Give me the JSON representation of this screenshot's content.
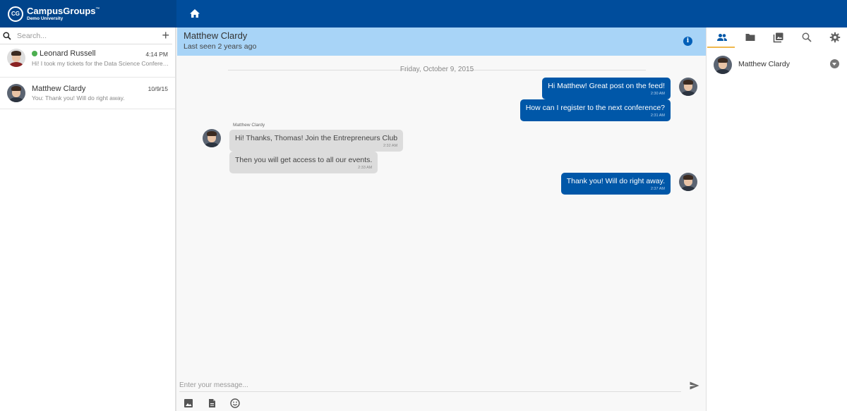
{
  "brand": {
    "name": "CampusGroups",
    "tm": "™",
    "sub": "Demo University",
    "logo_text": "CG"
  },
  "search": {
    "placeholder": "Search..."
  },
  "conversations": [
    {
      "name": "Leonard Russell",
      "time": "4:14 PM",
      "preview": "Hi! I took my tickets for the Data Science Conference!",
      "online": true
    },
    {
      "name": "Matthew Clardy",
      "time": "10/9/15",
      "preview": "You: Thank you! Will do right away.",
      "online": false
    }
  ],
  "chat": {
    "title": "Matthew Clardy",
    "status": "Last seen 2 years ago",
    "date_divider": "Friday, October 9, 2015",
    "messages": [
      {
        "direction": "out",
        "text": "Hi Matthew! Great post on the feed!",
        "time": "2:30 AM"
      },
      {
        "direction": "out",
        "text": "How can I register to the next conference?",
        "time": "2:31 AM"
      },
      {
        "direction": "in",
        "sender": "Matthew Clardy",
        "text": "Hi! Thanks, Thomas! Join the Entrepreneurs Club",
        "time": "2:32 AM"
      },
      {
        "direction": "in",
        "text": "Then you will get access to all our events.",
        "time": "2:33 AM"
      },
      {
        "direction": "out",
        "text": "Thank you! Will do right away.",
        "time": "2:37 AM"
      }
    ],
    "composer_placeholder": "Enter your message..."
  },
  "right_panel": {
    "tabs": [
      "people-icon",
      "folder-icon",
      "photos-icon",
      "search-icon",
      "settings-icon"
    ],
    "active_tab": "people-icon",
    "members": [
      {
        "name": "Matthew Clardy"
      }
    ]
  },
  "colors": {
    "topbar": "#004d9c",
    "out_bubble": "#0057a8",
    "in_bubble": "#dcdcdc",
    "header_bg": "#a8d4f7",
    "tab_underline": "#f0b84d"
  }
}
